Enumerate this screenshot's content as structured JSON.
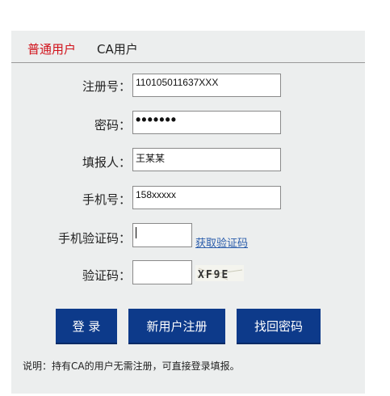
{
  "tabs": {
    "normal": "普通用户",
    "ca": "CA用户"
  },
  "form": {
    "reg_label": "注册号：",
    "reg_value": "110105011637XXX",
    "password_label": "密码：",
    "password_masked": "•••••••",
    "reporter_label": "填报人：",
    "reporter_value": "王某某",
    "phone_label": "手机号：",
    "phone_value": "158xxxxx",
    "sms_label": "手机验证码：",
    "sms_link": "获取验证码",
    "captcha_label": "验证码：",
    "captcha_text": "XF9E"
  },
  "buttons": {
    "login": "登 录",
    "register": "新用户注册",
    "recover": "找回密码"
  },
  "note": "说明：持有CA的用户无需注册，可直接登录填报。",
  "colors": {
    "active_tab": "#d1121b",
    "button_bg": "#0d3a8a",
    "link": "#2a5cab",
    "panel_bg": "#eceeee"
  }
}
